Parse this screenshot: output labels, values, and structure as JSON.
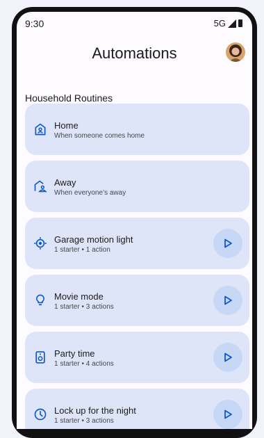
{
  "status_bar": {
    "time": "9:30",
    "network": "5G",
    "icons": [
      "signal-icon",
      "battery-icon"
    ]
  },
  "header": {
    "title": "Automations",
    "avatar": "profile-avatar"
  },
  "section": {
    "title": "Household Routines"
  },
  "routines": [
    {
      "title": "Home",
      "subtitle": "When someone comes home",
      "icon": "home-person-icon",
      "has_play": false
    },
    {
      "title": "Away",
      "subtitle": "When everyone’s away",
      "icon": "away-home-icon",
      "has_play": false
    },
    {
      "title": "Garage motion light",
      "subtitle": "1 starter • 1 action",
      "icon": "motion-sensor-icon",
      "has_play": true
    },
    {
      "title": "Movie mode",
      "subtitle": "1 starter • 3 actions",
      "icon": "lightbulb-icon",
      "has_play": true
    },
    {
      "title": "Party time",
      "subtitle": "1 starter • 4 actions",
      "icon": "speaker-icon",
      "has_play": true
    },
    {
      "title": "Lock up for the night",
      "subtitle": "1 starter • 3 actions",
      "icon": "clock-icon",
      "has_play": true
    }
  ],
  "colors": {
    "accent": "#0b57d0",
    "card_bg": "#dfe5f8",
    "play_bg": "#c7d8f7"
  }
}
